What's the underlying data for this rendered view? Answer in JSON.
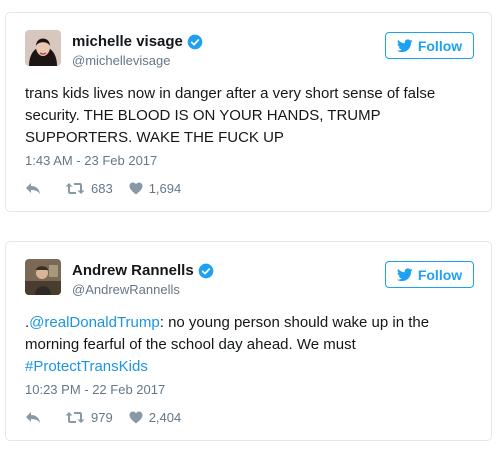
{
  "colors": {
    "accent": "#1da1f2",
    "link": "#1b95e0",
    "secondary_text": "#657786",
    "border": "#e1e8ed"
  },
  "tweets": [
    {
      "display_name": "michelle visage",
      "handle": "@michellevisage",
      "follow_label": "Follow",
      "text": "trans kids lives now in danger after a very short sense of false security. THE BLOOD IS ON YOUR HANDS, TRUMP SUPPORTERS. WAKE THE FUCK UP",
      "timestamp": "1:43 AM - 23 Feb 2017",
      "retweets": "683",
      "likes": "1,694"
    },
    {
      "display_name": "Andrew Rannells",
      "handle": "@AndrewRannells",
      "follow_label": "Follow",
      "text_prefix": ".",
      "mention": "@realDonaldTrump",
      "text_body": ": no young person should wake up in the morning fearful of the school day ahead. We must ",
      "hashtag": "#ProtectTransKids",
      "timestamp": "10:23 PM - 22 Feb 2017",
      "retweets": "979",
      "likes": "2,404"
    }
  ],
  "icons": {
    "verified": "verified-badge-icon",
    "bird": "twitter-bird-icon",
    "reply": "reply-icon",
    "retweet": "retweet-icon",
    "like": "heart-icon"
  }
}
